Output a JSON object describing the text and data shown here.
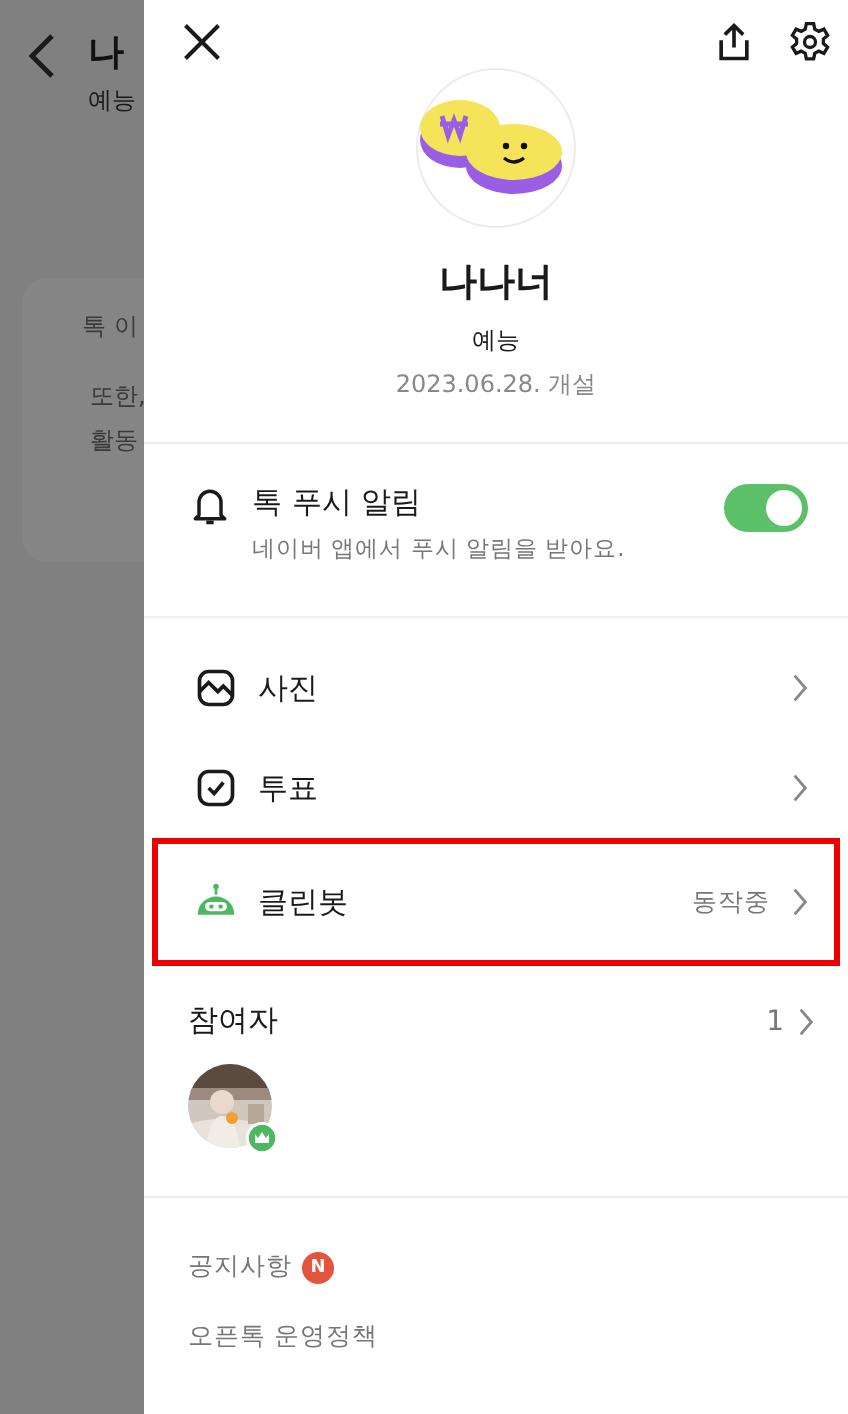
{
  "background": {
    "title": "나",
    "subtitle": "예능",
    "lines": [
      "톡 이",
      "또한,",
      "활동"
    ]
  },
  "drawer": {
    "profile": {
      "name": "나나너",
      "category": "예능",
      "created": "2023.06.28. 개설"
    },
    "push": {
      "title": "톡 푸시 알림",
      "description": "네이버 앱에서 푸시 알림을 받아요.",
      "on": true
    },
    "menu": [
      {
        "label": "사진",
        "highlighted": false
      },
      {
        "kind": "vote",
        "label": "투표",
        "highlighted": false
      },
      {
        "kind": "cleanbot",
        "label": "클린봇",
        "status": "동작중",
        "highlighted": true
      }
    ],
    "participants": {
      "title": "참여자",
      "count": "1",
      "members": [
        {
          "kind": "picture",
          "owner": true
        }
      ]
    },
    "footer_links": [
      {
        "label": "공지사항",
        "badge": "N"
      },
      {
        "label": "오픈톡 운영정책"
      }
    ]
  }
}
